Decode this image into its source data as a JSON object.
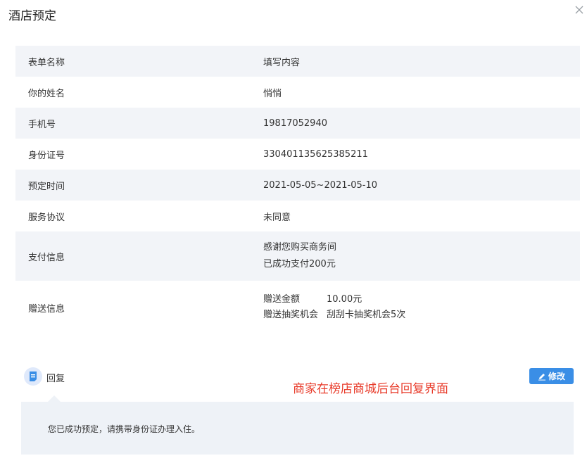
{
  "dialog": {
    "title": "酒店预定"
  },
  "form": {
    "header": {
      "name": "表单名称",
      "value": "填写内容"
    },
    "rows": [
      {
        "name": "你的姓名",
        "value": "悄悄"
      },
      {
        "name": "手机号",
        "value": "19817052940"
      },
      {
        "name": "身份证号",
        "value": "330401135625385211"
      },
      {
        "name": "预定时间",
        "value": "2021-05-05~2021-05-10"
      },
      {
        "name": "服务协议",
        "value": "未同意"
      }
    ],
    "payment": {
      "name": "支付信息",
      "lines": [
        "感谢您购买商务间",
        "已成功支付200元"
      ]
    },
    "gift": {
      "name": "赠送信息",
      "items": [
        {
          "key": "赠送金额",
          "value": "10.00元"
        },
        {
          "key": "赠送抽奖机会",
          "value": "刮刮卡抽奖机会5次"
        }
      ]
    }
  },
  "reply": {
    "label": "回复",
    "edit_label": "修改",
    "content": "您已成功预定，请携带身份证办理入住。"
  },
  "annotation": "商家在榜店商城后台回复界面",
  "colors": {
    "accent": "#3a8ee6",
    "annotation": "#e83b2a",
    "row_bg": "#f2f4f8",
    "reply_bg": "#eef2f7"
  },
  "icons": {
    "close": "close-icon",
    "reply": "message-icon",
    "edit": "pencil-icon"
  }
}
